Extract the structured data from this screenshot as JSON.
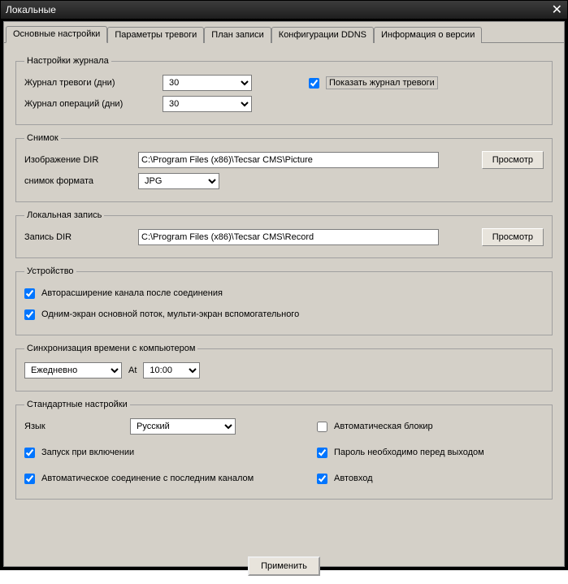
{
  "window": {
    "title": "Локальные"
  },
  "tabs": [
    "Основные настройки",
    "Параметры тревоги",
    "План записи",
    "Конфигурации DDNS",
    "Информация о версии"
  ],
  "log_settings": {
    "legend": "Настройки журнала",
    "alarm_log_label": "Журнал тревоги (дни)",
    "alarm_log_value": "30",
    "op_log_label": "Журнал операций (дни)",
    "op_log_value": "30",
    "show_alarm_log_label": "Показать журнал тревоги"
  },
  "snapshot": {
    "legend": "Снимок",
    "dir_label": "Изображение DIR",
    "dir_value": "C:\\Program Files (x86)\\Tecsar CMS\\Picture",
    "format_label": "снимок формата",
    "format_value": "JPG",
    "browse": "Просмотр"
  },
  "record": {
    "legend": "Локальная запись",
    "dir_label": "Запись DIR",
    "dir_value": "C:\\Program Files (x86)\\Tecsar CMS\\Record",
    "browse": "Просмотр"
  },
  "device": {
    "legend": "Устройство",
    "auto_expand_label": "Авторасширение канала после соединения",
    "stream_label": "Одним-экран основной поток, мульти-экран вспомогательного"
  },
  "sync": {
    "legend": "Синхронизация времени с компьютером",
    "freq_value": "Ежедневно",
    "at_label": "At",
    "time_value": "10:00"
  },
  "defaults": {
    "legend": "Стандартные настройки",
    "lang_label": "Язык",
    "lang_value": "Русский",
    "auto_lock_label": "Автоматическая блокир",
    "startup_label": "Запуск при включении",
    "pwd_exit_label": "Пароль необходимо перед выходом",
    "auto_connect_label": "Автоматическое соединение с последним каналом",
    "auto_login_label": "Автовход"
  },
  "apply_label": "Применить"
}
